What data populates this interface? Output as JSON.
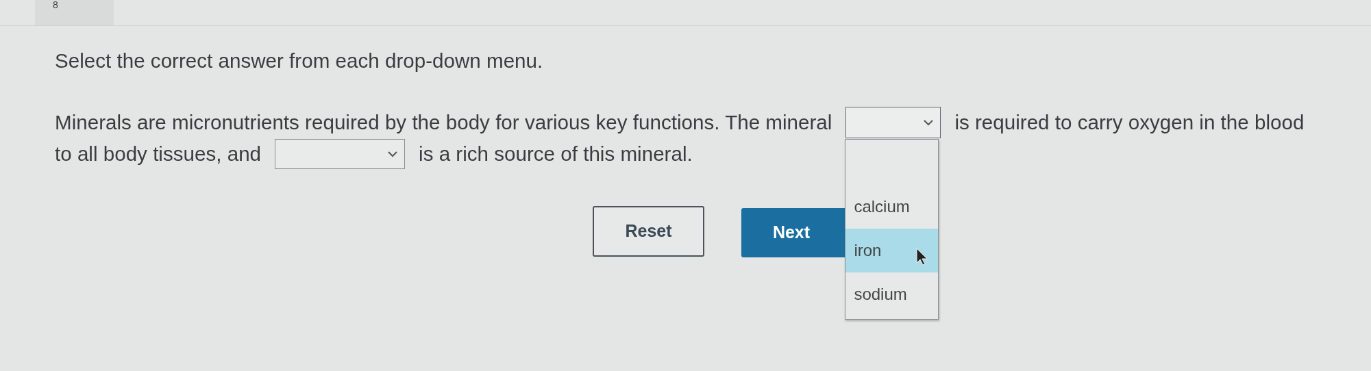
{
  "question_number": "8",
  "instruction": "Select the correct answer from each drop-down menu.",
  "lines": [
    [
      {
        "kind": "text",
        "text": "Minerals are micronutrients required by the body for various key functions. The mineral"
      },
      {
        "kind": "dropdown",
        "open": true,
        "options": [
          {
            "label": "calcium",
            "selected": false
          },
          {
            "label": "iron",
            "selected": true
          },
          {
            "label": "sodium",
            "selected": false
          }
        ]
      },
      {
        "kind": "text",
        "text": "is required to carry oxygen in the blood"
      }
    ],
    [
      {
        "kind": "text",
        "text": "to all body tissues, and"
      },
      {
        "kind": "dropdown"
      },
      {
        "kind": "text",
        "text": "is a rich source of this mineral."
      }
    ]
  ],
  "buttons": [
    {
      "label": "Reset",
      "kind": "outline"
    },
    {
      "label": "Next",
      "kind": "primary"
    }
  ]
}
